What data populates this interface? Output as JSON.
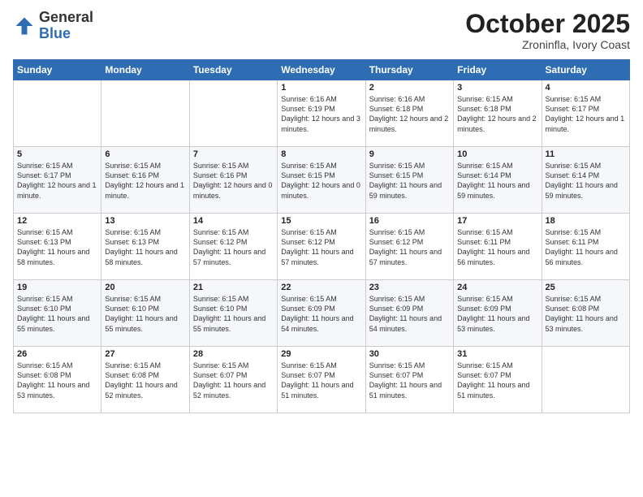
{
  "header": {
    "logo_general": "General",
    "logo_blue": "Blue",
    "month_title": "October 2025",
    "location": "Zroninfla, Ivory Coast"
  },
  "days_of_week": [
    "Sunday",
    "Monday",
    "Tuesday",
    "Wednesday",
    "Thursday",
    "Friday",
    "Saturday"
  ],
  "weeks": [
    [
      {
        "day": "",
        "text": ""
      },
      {
        "day": "",
        "text": ""
      },
      {
        "day": "",
        "text": ""
      },
      {
        "day": "1",
        "text": "Sunrise: 6:16 AM\nSunset: 6:19 PM\nDaylight: 12 hours and 3 minutes."
      },
      {
        "day": "2",
        "text": "Sunrise: 6:16 AM\nSunset: 6:18 PM\nDaylight: 12 hours and 2 minutes."
      },
      {
        "day": "3",
        "text": "Sunrise: 6:15 AM\nSunset: 6:18 PM\nDaylight: 12 hours and 2 minutes."
      },
      {
        "day": "4",
        "text": "Sunrise: 6:15 AM\nSunset: 6:17 PM\nDaylight: 12 hours and 1 minute."
      }
    ],
    [
      {
        "day": "5",
        "text": "Sunrise: 6:15 AM\nSunset: 6:17 PM\nDaylight: 12 hours and 1 minute."
      },
      {
        "day": "6",
        "text": "Sunrise: 6:15 AM\nSunset: 6:16 PM\nDaylight: 12 hours and 1 minute."
      },
      {
        "day": "7",
        "text": "Sunrise: 6:15 AM\nSunset: 6:16 PM\nDaylight: 12 hours and 0 minutes."
      },
      {
        "day": "8",
        "text": "Sunrise: 6:15 AM\nSunset: 6:15 PM\nDaylight: 12 hours and 0 minutes."
      },
      {
        "day": "9",
        "text": "Sunrise: 6:15 AM\nSunset: 6:15 PM\nDaylight: 11 hours and 59 minutes."
      },
      {
        "day": "10",
        "text": "Sunrise: 6:15 AM\nSunset: 6:14 PM\nDaylight: 11 hours and 59 minutes."
      },
      {
        "day": "11",
        "text": "Sunrise: 6:15 AM\nSunset: 6:14 PM\nDaylight: 11 hours and 59 minutes."
      }
    ],
    [
      {
        "day": "12",
        "text": "Sunrise: 6:15 AM\nSunset: 6:13 PM\nDaylight: 11 hours and 58 minutes."
      },
      {
        "day": "13",
        "text": "Sunrise: 6:15 AM\nSunset: 6:13 PM\nDaylight: 11 hours and 58 minutes."
      },
      {
        "day": "14",
        "text": "Sunrise: 6:15 AM\nSunset: 6:12 PM\nDaylight: 11 hours and 57 minutes."
      },
      {
        "day": "15",
        "text": "Sunrise: 6:15 AM\nSunset: 6:12 PM\nDaylight: 11 hours and 57 minutes."
      },
      {
        "day": "16",
        "text": "Sunrise: 6:15 AM\nSunset: 6:12 PM\nDaylight: 11 hours and 57 minutes."
      },
      {
        "day": "17",
        "text": "Sunrise: 6:15 AM\nSunset: 6:11 PM\nDaylight: 11 hours and 56 minutes."
      },
      {
        "day": "18",
        "text": "Sunrise: 6:15 AM\nSunset: 6:11 PM\nDaylight: 11 hours and 56 minutes."
      }
    ],
    [
      {
        "day": "19",
        "text": "Sunrise: 6:15 AM\nSunset: 6:10 PM\nDaylight: 11 hours and 55 minutes."
      },
      {
        "day": "20",
        "text": "Sunrise: 6:15 AM\nSunset: 6:10 PM\nDaylight: 11 hours and 55 minutes."
      },
      {
        "day": "21",
        "text": "Sunrise: 6:15 AM\nSunset: 6:10 PM\nDaylight: 11 hours and 55 minutes."
      },
      {
        "day": "22",
        "text": "Sunrise: 6:15 AM\nSunset: 6:09 PM\nDaylight: 11 hours and 54 minutes."
      },
      {
        "day": "23",
        "text": "Sunrise: 6:15 AM\nSunset: 6:09 PM\nDaylight: 11 hours and 54 minutes."
      },
      {
        "day": "24",
        "text": "Sunrise: 6:15 AM\nSunset: 6:09 PM\nDaylight: 11 hours and 53 minutes."
      },
      {
        "day": "25",
        "text": "Sunrise: 6:15 AM\nSunset: 6:08 PM\nDaylight: 11 hours and 53 minutes."
      }
    ],
    [
      {
        "day": "26",
        "text": "Sunrise: 6:15 AM\nSunset: 6:08 PM\nDaylight: 11 hours and 53 minutes."
      },
      {
        "day": "27",
        "text": "Sunrise: 6:15 AM\nSunset: 6:08 PM\nDaylight: 11 hours and 52 minutes."
      },
      {
        "day": "28",
        "text": "Sunrise: 6:15 AM\nSunset: 6:07 PM\nDaylight: 11 hours and 52 minutes."
      },
      {
        "day": "29",
        "text": "Sunrise: 6:15 AM\nSunset: 6:07 PM\nDaylight: 11 hours and 51 minutes."
      },
      {
        "day": "30",
        "text": "Sunrise: 6:15 AM\nSunset: 6:07 PM\nDaylight: 11 hours and 51 minutes."
      },
      {
        "day": "31",
        "text": "Sunrise: 6:15 AM\nSunset: 6:07 PM\nDaylight: 11 hours and 51 minutes."
      },
      {
        "day": "",
        "text": ""
      }
    ]
  ]
}
